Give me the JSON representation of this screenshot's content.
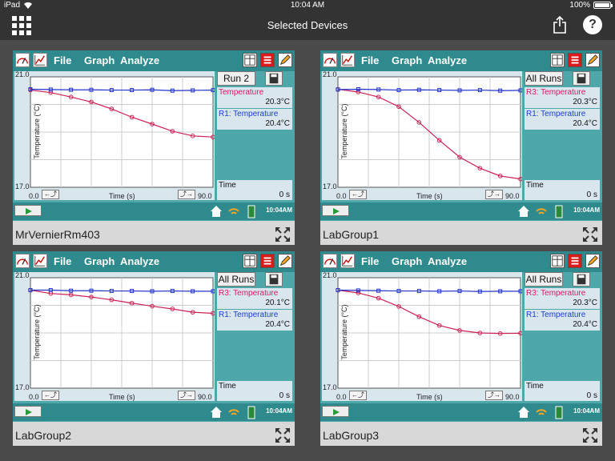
{
  "status": {
    "device": "iPad",
    "time": "10:04 AM",
    "battery": "100%"
  },
  "nav": {
    "title": "Selected Devices"
  },
  "colors": {
    "teal": "#4ea7a9",
    "blue_series": "#2233cc",
    "red_series": "#cc2255"
  },
  "devices": [
    {
      "name": "MrVernierRm403",
      "menu": [
        "File",
        "Graph",
        "Analyze"
      ],
      "run_label": "Run 2",
      "meters": [
        {
          "name": "Temperature",
          "value": "20.3°C",
          "color": "#d81b60"
        },
        {
          "name": "R1: Temperature",
          "value": "20.4°C",
          "color": "#1a3fcc"
        }
      ],
      "time_label": "Time",
      "time_value": "0 s",
      "clock": "10:04AM",
      "ylabel": "Temperature (°C)",
      "xlabel": "Time (s)",
      "ymax": "21.0",
      "ymin": "17.0",
      "xmin": "0.0",
      "xmax": "90.0",
      "red": [
        [
          0,
          20.52
        ],
        [
          10,
          20.43
        ],
        [
          20,
          20.27
        ],
        [
          30,
          20.09
        ],
        [
          40,
          19.84
        ],
        [
          50,
          19.54
        ],
        [
          60,
          19.29
        ],
        [
          70,
          19.03
        ],
        [
          80,
          18.86
        ],
        [
          90,
          18.82
        ]
      ],
      "blue": [
        [
          0,
          20.55
        ],
        [
          10,
          20.54
        ],
        [
          20,
          20.53
        ],
        [
          30,
          20.53
        ],
        [
          40,
          20.52
        ],
        [
          50,
          20.52
        ],
        [
          60,
          20.53
        ],
        [
          70,
          20.5
        ],
        [
          80,
          20.51
        ],
        [
          90,
          20.52
        ]
      ]
    },
    {
      "name": "LabGroup1",
      "menu": [
        "File",
        "Graph",
        "Analyze"
      ],
      "run_label": "All Runs",
      "meters": [
        {
          "name": "R3: Temperature",
          "value": "20.3°C",
          "color": "#d81b60"
        },
        {
          "name": "R1: Temperature",
          "value": "20.4°C",
          "color": "#1a3fcc"
        }
      ],
      "time_label": "Time",
      "time_value": "0 s",
      "clock": "10:04AM",
      "ylabel": "Temperature (°C)",
      "xlabel": "Time (s)",
      "ymax": "21.0",
      "ymin": "17.0",
      "xmin": "0.0",
      "xmax": "90.0",
      "red": [
        [
          0,
          20.55
        ],
        [
          10,
          20.45
        ],
        [
          20,
          20.27
        ],
        [
          30,
          19.92
        ],
        [
          40,
          19.35
        ],
        [
          50,
          18.7
        ],
        [
          60,
          18.09
        ],
        [
          70,
          17.69
        ],
        [
          80,
          17.41
        ],
        [
          90,
          17.3
        ]
      ],
      "blue": [
        [
          0,
          20.54
        ],
        [
          10,
          20.55
        ],
        [
          20,
          20.54
        ],
        [
          30,
          20.52
        ],
        [
          40,
          20.53
        ],
        [
          50,
          20.52
        ],
        [
          60,
          20.51
        ],
        [
          70,
          20.52
        ],
        [
          80,
          20.5
        ],
        [
          90,
          20.51
        ]
      ]
    },
    {
      "name": "LabGroup2",
      "menu": [
        "File",
        "Graph",
        "Analyze"
      ],
      "run_label": "All Runs",
      "meters": [
        {
          "name": "R3: Temperature",
          "value": "20.1°C",
          "color": "#d81b60"
        },
        {
          "name": "R1: Temperature",
          "value": "20.4°C",
          "color": "#1a3fcc"
        }
      ],
      "time_label": "Time",
      "time_value": "0 s",
      "clock": "10:04AM",
      "ylabel": "Temperature (°C)",
      "xlabel": "Time (s)",
      "ymax": "21.0",
      "ymin": "17.0",
      "xmin": "0.0",
      "xmax": "90.0",
      "red": [
        [
          0,
          20.55
        ],
        [
          10,
          20.43
        ],
        [
          20,
          20.38
        ],
        [
          30,
          20.3
        ],
        [
          40,
          20.2
        ],
        [
          50,
          20.08
        ],
        [
          60,
          19.97
        ],
        [
          70,
          19.87
        ],
        [
          80,
          19.75
        ],
        [
          90,
          19.71
        ]
      ],
      "blue": [
        [
          0,
          20.55
        ],
        [
          10,
          20.55
        ],
        [
          20,
          20.53
        ],
        [
          30,
          20.53
        ],
        [
          40,
          20.52
        ],
        [
          50,
          20.52
        ],
        [
          60,
          20.51
        ],
        [
          70,
          20.52
        ],
        [
          80,
          20.51
        ],
        [
          90,
          20.51
        ]
      ]
    },
    {
      "name": "LabGroup3",
      "menu": [
        "File",
        "Graph",
        "Analyze"
      ],
      "run_label": "All Runs",
      "meters": [
        {
          "name": "R3: Temperature",
          "value": "20.3°C",
          "color": "#d81b60"
        },
        {
          "name": "R1: Temperature",
          "value": "20.4°C",
          "color": "#1a3fcc"
        }
      ],
      "time_label": "Time",
      "time_value": "0 s",
      "clock": "10:04AM",
      "ylabel": "Temperature (°C)",
      "xlabel": "Time (s)",
      "ymax": "21.0",
      "ymin": "17.0",
      "xmin": "0.0",
      "xmax": "90.0",
      "red": [
        [
          0,
          20.55
        ],
        [
          10,
          20.45
        ],
        [
          20,
          20.26
        ],
        [
          30,
          19.96
        ],
        [
          40,
          19.59
        ],
        [
          50,
          19.27
        ],
        [
          60,
          19.09
        ],
        [
          70,
          19.0
        ],
        [
          80,
          18.98
        ],
        [
          90,
          18.99
        ]
      ],
      "blue": [
        [
          0,
          20.55
        ],
        [
          10,
          20.54
        ],
        [
          20,
          20.53
        ],
        [
          30,
          20.52
        ],
        [
          40,
          20.52
        ],
        [
          50,
          20.51
        ],
        [
          60,
          20.52
        ],
        [
          70,
          20.5
        ],
        [
          80,
          20.51
        ],
        [
          90,
          20.51
        ]
      ]
    }
  ]
}
